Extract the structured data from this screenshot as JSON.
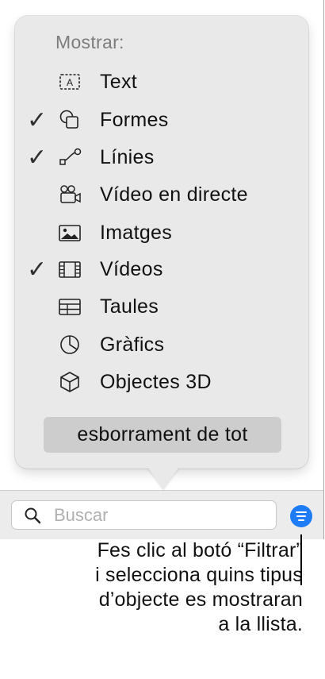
{
  "popover": {
    "title": "Mostrar:",
    "items": [
      {
        "label": "Text",
        "icon": "text-box-icon",
        "checked": false
      },
      {
        "label": "Formes",
        "icon": "shapes-icon",
        "checked": true
      },
      {
        "label": "Línies",
        "icon": "lines-icon",
        "checked": true
      },
      {
        "label": "Vídeo en directe",
        "icon": "live-video-icon",
        "checked": false
      },
      {
        "label": "Imatges",
        "icon": "image-icon",
        "checked": false
      },
      {
        "label": "Vídeos",
        "icon": "film-icon",
        "checked": true
      },
      {
        "label": "Taules",
        "icon": "table-icon",
        "checked": false
      },
      {
        "label": "Gràfics",
        "icon": "pie-chart-icon",
        "checked": false
      },
      {
        "label": "Objectes 3D",
        "icon": "cube-icon",
        "checked": false
      }
    ],
    "check_glyph": "✓",
    "clear_label": "esborrament de tot"
  },
  "search": {
    "placeholder": "Buscar",
    "value": ""
  },
  "filter_button": {
    "color": "#1e7cf7"
  },
  "caption": {
    "lines": [
      "Fes clic al botó “Filtrar”",
      "i selecciona quins tipus",
      "d’objecte es mostraran",
      "a la llista."
    ]
  }
}
